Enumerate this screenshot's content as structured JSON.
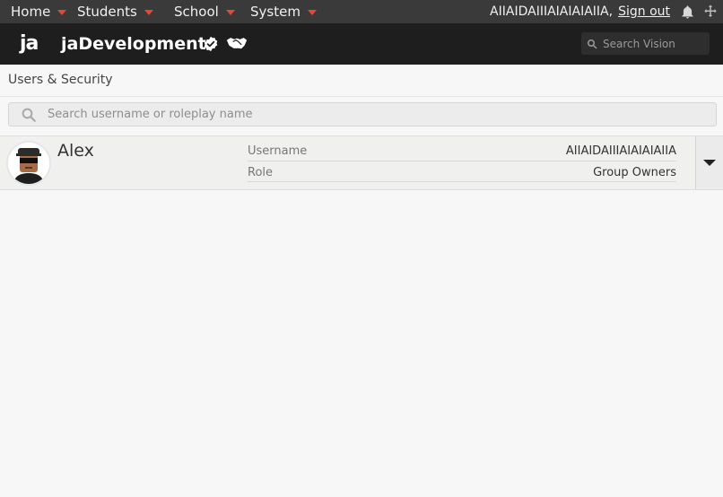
{
  "topbar": {
    "menu": [
      {
        "label": "Home"
      },
      {
        "label": "Students"
      },
      {
        "label": "School"
      },
      {
        "label": "System"
      }
    ],
    "username": "AIIAIDAIIIAIAIAIAIIA,",
    "signout_label": "Sign out",
    "icons": [
      "bell-icon",
      "move-icon"
    ],
    "accent_color": "#e24a35"
  },
  "header": {
    "logo_text": "ja",
    "org_name": "jaDevelopment",
    "icons": [
      "verified-badge-icon",
      "handshake-icon"
    ],
    "search_placeholder": "Search Vision"
  },
  "page": {
    "title": "Users & Security",
    "search_placeholder": "Search username or roleplay name"
  },
  "users": [
    {
      "name": "Alex",
      "username_label": "Username",
      "username": "AIIAIDAIIIAIAIAIAIIA",
      "role_label": "Role",
      "role": "Group Owners"
    }
  ]
}
